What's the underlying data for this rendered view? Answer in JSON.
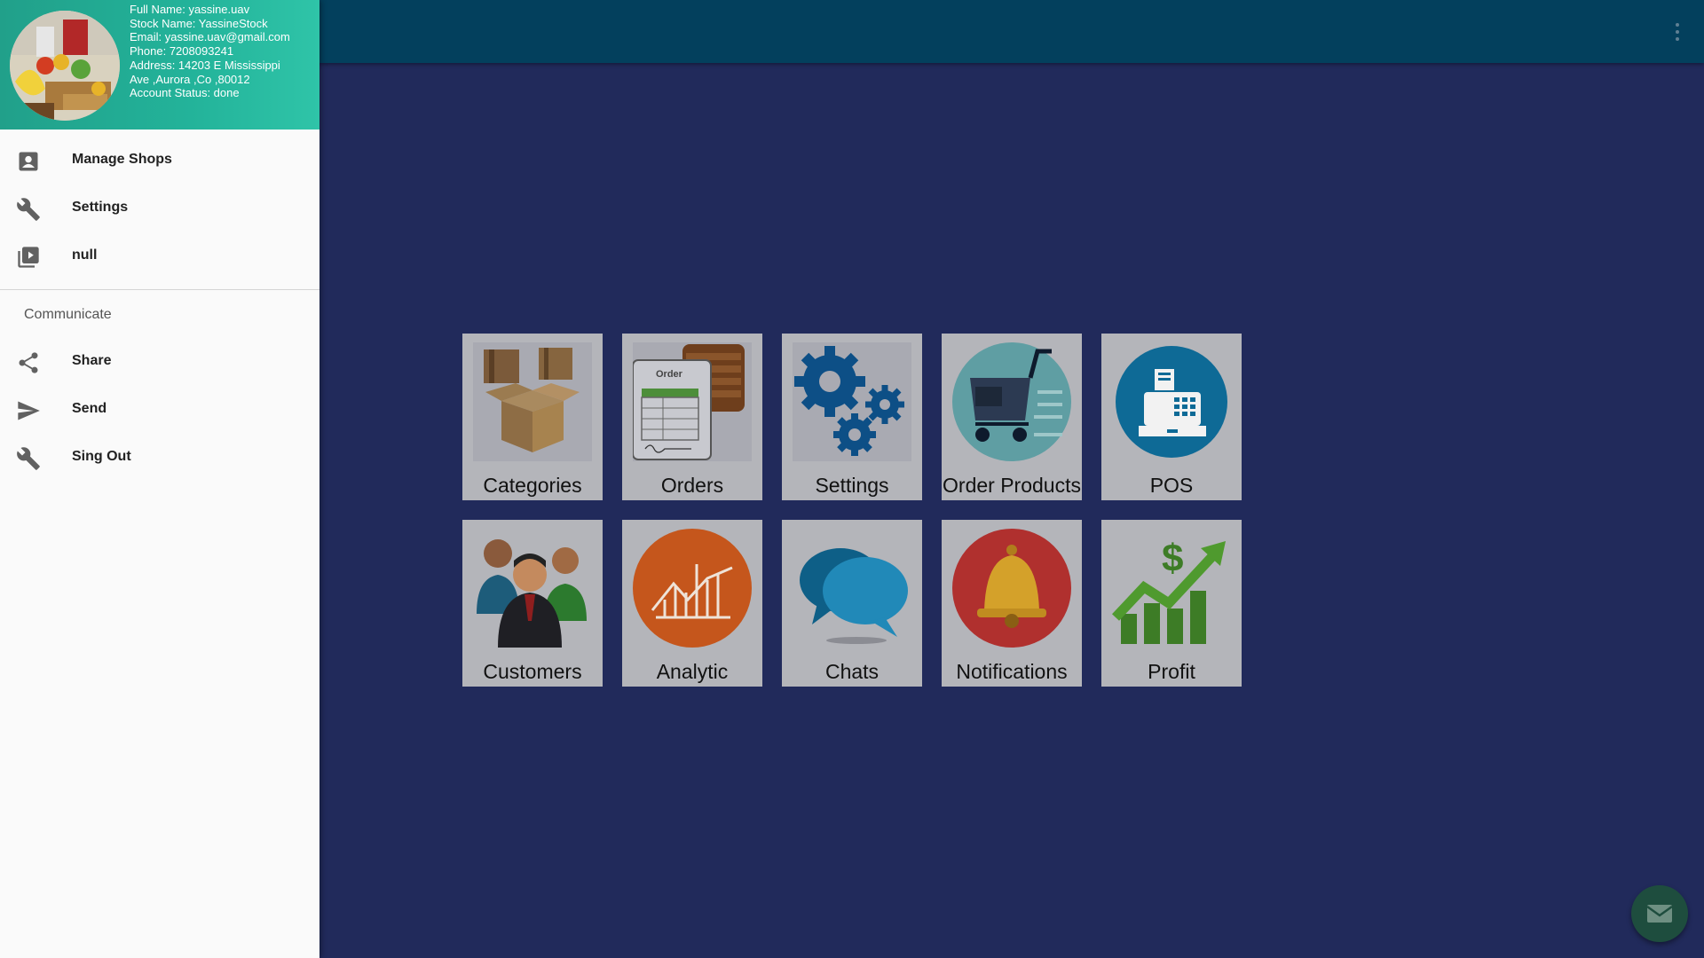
{
  "profile": {
    "full_name": "Full Name: yassine.uav",
    "stock_name": "Stock Name: YassineStock",
    "email": "Email: yassine.uav@gmail.com",
    "phone": "Phone: 7208093241",
    "address_line1": "Address: 14203 E Mississippi",
    "address_line2": "Ave ,Aurora ,Co ,80012",
    "status": "Account Status: done"
  },
  "drawer": {
    "items": [
      {
        "label": "Manage Shops",
        "icon": "account-box-icon"
      },
      {
        "label": "Settings",
        "icon": "wrench-icon"
      },
      {
        "label": "null",
        "icon": "video-library-icon"
      }
    ],
    "section_title": "Communicate",
    "communicate_items": [
      {
        "label": "Share",
        "icon": "share-icon"
      },
      {
        "label": "Send",
        "icon": "send-icon"
      },
      {
        "label": "Sing Out",
        "icon": "wrench-icon"
      }
    ]
  },
  "tiles": [
    {
      "label": "Categories",
      "icon": "boxes-icon"
    },
    {
      "label": "Orders",
      "icon": "order-form-icon",
      "art_text": "Order"
    },
    {
      "label": "Settings",
      "icon": "gears-icon"
    },
    {
      "label": "Order Products",
      "icon": "shopping-cart-icon"
    },
    {
      "label": "POS",
      "icon": "cash-register-icon"
    },
    {
      "label": "Customers",
      "icon": "people-icon"
    },
    {
      "label": "Analytic",
      "icon": "analytics-chart-icon"
    },
    {
      "label": "Chats",
      "icon": "chat-bubbles-icon"
    },
    {
      "label": "Notifications",
      "icon": "bell-icon"
    },
    {
      "label": "Profit",
      "icon": "profit-growth-icon"
    }
  ],
  "colors": {
    "appbar": "#03405d",
    "content_bg": "#212a5b",
    "drawer_header": "#23b39a",
    "fab": "#1e4d3e"
  }
}
